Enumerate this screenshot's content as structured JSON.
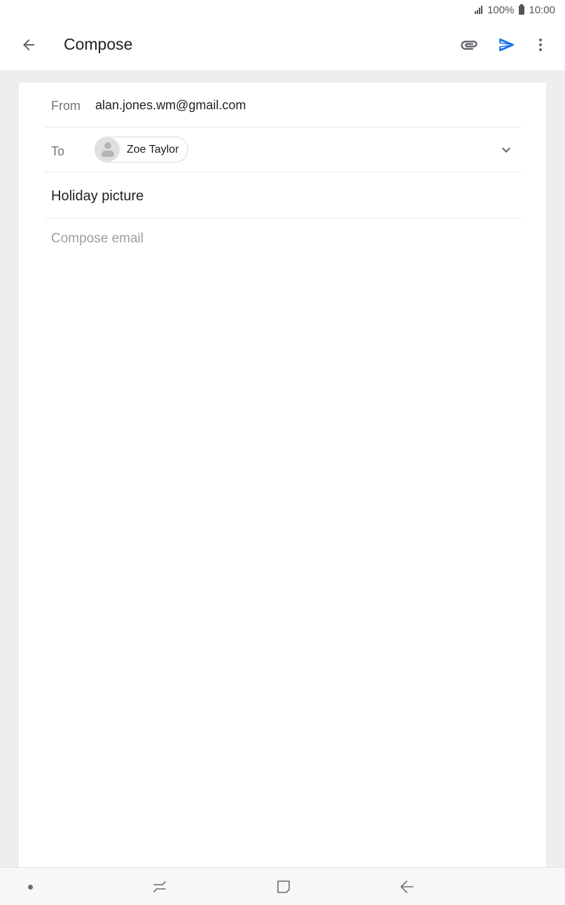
{
  "status_bar": {
    "battery_percent": "100%",
    "time": "10:00"
  },
  "app_bar": {
    "title": "Compose",
    "accent_color": "#1a73e8"
  },
  "compose": {
    "from_label": "From",
    "from_value": "alan.jones.wm@gmail.com",
    "to_label": "To",
    "recipients": [
      {
        "name": "Zoe Taylor"
      }
    ],
    "subject": "Holiday picture",
    "body_placeholder": "Compose email",
    "body_value": ""
  },
  "icons": {
    "back": "arrow-back-icon",
    "attach": "paperclip-icon",
    "send": "send-icon",
    "more": "more-vert-icon",
    "expand": "chevron-down-icon"
  }
}
